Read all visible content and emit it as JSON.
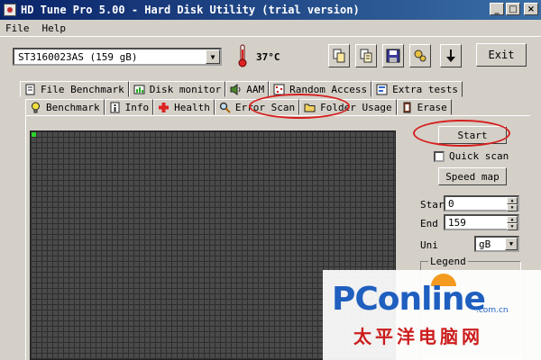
{
  "window": {
    "title": "HD Tune Pro 5.00 - Hard Disk Utility (trial version)",
    "buttons": {
      "minimize": "_",
      "maximize": "□",
      "close": "×"
    }
  },
  "menu": {
    "file": "File",
    "help": "Help"
  },
  "toolbar": {
    "drive": "ST3160023AS (159 gB)",
    "temperature": "37°C",
    "exit_label": "Exit",
    "icons": [
      "copy-icon",
      "copy-info-icon",
      "save-icon",
      "options-icon",
      "download-icon"
    ]
  },
  "tabs_top": [
    {
      "label": "File Benchmark",
      "icon": "file-benchmark-icon"
    },
    {
      "label": "Disk monitor",
      "icon": "disk-monitor-icon"
    },
    {
      "label": "AAM",
      "icon": "speaker-icon"
    },
    {
      "label": "Random Access",
      "icon": "random-access-icon"
    },
    {
      "label": "Extra tests",
      "icon": "extra-tests-icon"
    }
  ],
  "tabs_bottom": [
    {
      "label": "Benchmark",
      "icon": "benchmark-icon"
    },
    {
      "label": "Info",
      "icon": "info-icon"
    },
    {
      "label": "Health",
      "icon": "health-icon"
    },
    {
      "label": "Error Scan",
      "icon": "magnifier-icon",
      "active": true
    },
    {
      "label": "Folder Usage",
      "icon": "folder-icon"
    },
    {
      "label": "Erase",
      "icon": "erase-icon"
    }
  ],
  "scan": {
    "start_label": "Start",
    "quick_scan_label": "Quick scan",
    "quick_scan_checked": false,
    "speed_map_label": "Speed map",
    "start_field_label": "Star",
    "start_value": "0",
    "end_field_label": "End",
    "end_value": "159",
    "unit_label": "Uni",
    "unit_value": "gB",
    "legend_label": "Legend"
  },
  "colors": {
    "titlebar": "#0a246a",
    "annotation": "#d61f1f",
    "block_ok": "#2bd42b",
    "block_grid": "#4a4a4a"
  },
  "watermark": {
    "brand": "PConline",
    "domain": ".com.cn",
    "chinese": "太平洋电脑网"
  }
}
